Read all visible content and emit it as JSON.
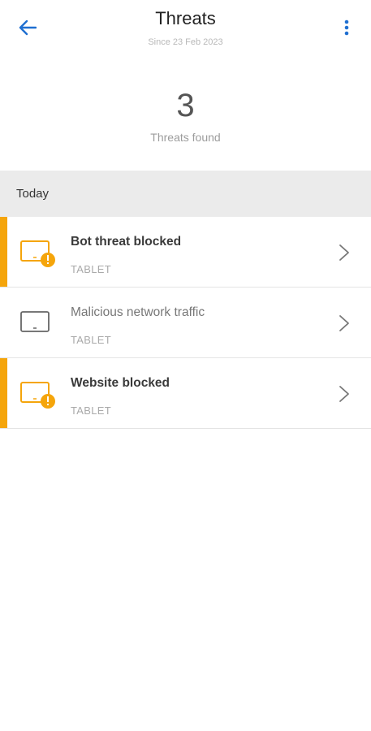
{
  "header": {
    "title": "Threats",
    "subtitle": "Since 23 Feb 2023",
    "back_icon": "arrow-left-icon",
    "menu_icon": "more-vert-icon"
  },
  "summary": {
    "count": "3",
    "label": "Threats found"
  },
  "section": {
    "label": "Today"
  },
  "threats": [
    {
      "title": "Bot threat blocked",
      "device": "TABLET",
      "severity": "warning",
      "icon": "tablet-warning-icon"
    },
    {
      "title": "Malicious network traffic",
      "device": "TABLET",
      "severity": "info",
      "icon": "tablet-icon"
    },
    {
      "title": "Website blocked",
      "device": "TABLET",
      "severity": "warning",
      "icon": "tablet-warning-icon"
    }
  ],
  "colors": {
    "accent": "#1f6fd1",
    "warning": "#f5a50b",
    "section_bg": "#ebebeb"
  }
}
